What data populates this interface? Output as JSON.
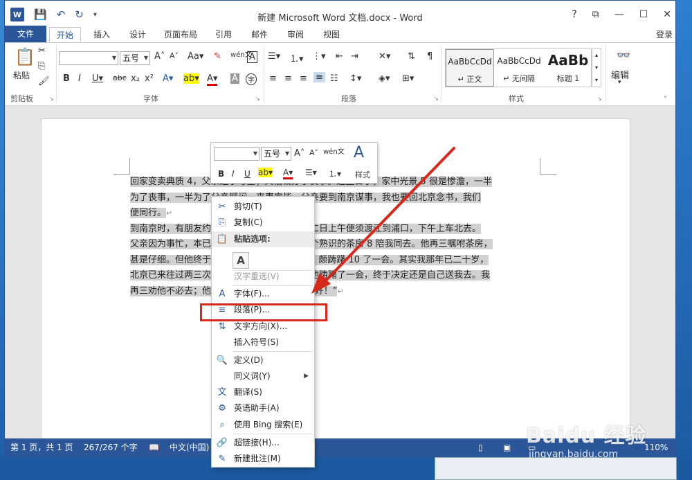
{
  "window": {
    "title": "新建 Microsoft Word 文档.docx - Word",
    "controls": [
      "?",
      "⧉",
      "—",
      "☐",
      "✕"
    ]
  },
  "qat": {
    "logo": "W"
  },
  "tabs": [
    {
      "label": "文件"
    },
    {
      "label": "开始"
    },
    {
      "label": "插入"
    },
    {
      "label": "设计"
    },
    {
      "label": "页面布局"
    },
    {
      "label": "引用"
    },
    {
      "label": "邮件"
    },
    {
      "label": "审阅"
    },
    {
      "label": "视图"
    }
  ],
  "login": "登录",
  "ribbon": {
    "clipboard": {
      "paste_label": "粘贴",
      "group_label": "剪贴板"
    },
    "font": {
      "font_name": "",
      "font_size": "五号",
      "group_label": "字体"
    },
    "paragraph": {
      "group_label": "段落"
    },
    "styles": {
      "group_label": "样式",
      "items": [
        {
          "sample": "AaBbCcDd",
          "name": "↵ 正文"
        },
        {
          "sample": "AaBbCcDd",
          "name": "↵ 无间隔"
        },
        {
          "sample": "AaBb",
          "name": "标题 1"
        }
      ]
    },
    "editing": {
      "label": "编辑"
    }
  },
  "document": {
    "lines": [
      {
        "text": "回家变卖典质 4，父亲还了亏空；又借钱办了丧事。这些日子，家中光景 5 很是惨澹，一半",
        "hl": true
      },
      {
        "text": "为了丧事，一半为了父亲赋闲。丧事完毕，父亲要到南京谋事，我也要回北京念书，我们",
        "hl": true
      },
      {
        "text": "便同行。",
        "hl": true,
        "pm": "↵"
      },
      {
        "text": "到南京时，有朋友约去游逛，勾留了一日；第二日上午便须渡江到浦口，下午上车北去。",
        "hl": true
      },
      {
        "text": "父亲因为事忙，本已说定不送我，叫旅馆里一个熟识的茶房 8 陪我同去。他再三嘱咐茶房，",
        "hl": true
      },
      {
        "text": "甚是仔细。但他终于不放心，怕茶房不妥帖 9；颇踌躇 10 了一会。其实我那年已二十岁，",
        "hl": true
      },
      {
        "text": "北京已来往过两三次，是没有什么要紧的了。他踌躇了一会，终于决定还是自己送我去。我",
        "hl": true
      },
      {
        "text": "再三劝他不必去；他只说，“不要紧，他们去不好！”",
        "hl": true,
        "pm": "↵"
      }
    ]
  },
  "mini_toolbar": {
    "font_size": "五号",
    "style_label": "样式"
  },
  "context_menu": {
    "items": [
      {
        "label": "剪切(T)",
        "icon": "✂"
      },
      {
        "label": "复制(C)",
        "icon": "⎘"
      },
      {
        "label": "粘贴选项:",
        "icon": "📋",
        "header": true
      },
      {
        "label": "汉字重选(V)",
        "disabled": true
      },
      {
        "label": "字体(F)...",
        "icon": "A"
      },
      {
        "label": "段落(P)...",
        "icon": "≡"
      },
      {
        "label": "文字方向(X)...",
        "icon": "⇅"
      },
      {
        "label": "插入符号(S)"
      },
      {
        "label": "定义(D)",
        "icon": "🔍"
      },
      {
        "label": "同义词(Y)",
        "submenu": true
      },
      {
        "label": "翻译(S)",
        "icon": "文"
      },
      {
        "label": "英语助手(A)",
        "icon": "⚙"
      },
      {
        "label": "使用 Bing 搜索(E)",
        "icon": "⌕"
      },
      {
        "label": "超链接(H)...",
        "icon": "🔗"
      },
      {
        "label": "新建批注(M)",
        "icon": "✎"
      }
    ],
    "paste_option": "A"
  },
  "status": {
    "page": "第 1 页，共 1 页",
    "words": "267/267 个字",
    "lang": "中文(中国)",
    "zoom": "110%"
  },
  "watermark": {
    "logo": "Baidu 经验",
    "url": "jingyan.baidu.com"
  },
  "colors": {
    "accent": "#2b579a",
    "highlight": "#d7281c"
  }
}
